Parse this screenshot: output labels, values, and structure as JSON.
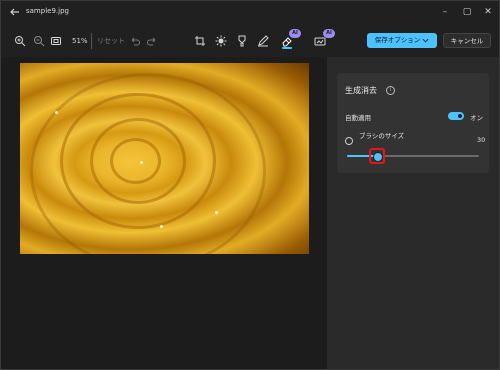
{
  "window": {
    "title": "sample9.jpg",
    "controls": [
      "–",
      "▢",
      "✕"
    ]
  },
  "toolbar": {
    "zoom_value": "51%",
    "reset_label": "リセット",
    "ai_badge": "AI",
    "save_label": "保存オプション",
    "cancel_label": "キャンセル"
  },
  "panel": {
    "title": "生成消去",
    "auto_apply_label": "自動適用",
    "toggle_state": "オン",
    "toggle_on": true,
    "brush_size_label": "ブラシのサイズ",
    "brush_size_value": "30",
    "brush_size_fraction": 0.22
  },
  "colors": {
    "accent": "#4cc2ff",
    "highlight": "#e8141a",
    "ai_badge": "#9b8cf0"
  },
  "icons": [
    "back-arrow-icon",
    "zoom-in-icon",
    "zoom-out-icon",
    "fit-view-icon",
    "undo-icon",
    "redo-icon",
    "crop-icon",
    "brightness-icon",
    "filter-icon",
    "markup-icon",
    "erase-icon",
    "background-icon",
    "info-icon",
    "brush-icon",
    "chevron-down-icon"
  ]
}
